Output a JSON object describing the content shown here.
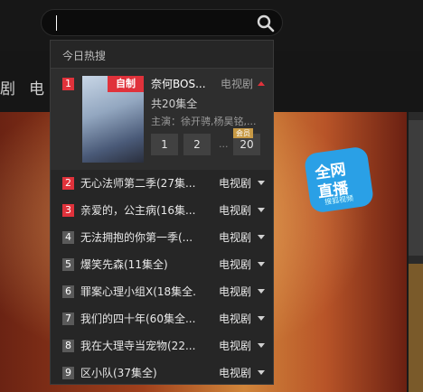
{
  "search": {
    "value": ""
  },
  "nav": {
    "items": [
      "剧",
      "电"
    ]
  },
  "live_badge": {
    "line1": "全网",
    "line2": "直播",
    "line3": "搜狐视频"
  },
  "dropdown": {
    "heading": "今日热搜",
    "featured": {
      "rank": "1",
      "poster_tag": "自制",
      "title": "奈何BOS...",
      "category": "电视剧",
      "episodes_total": "共20集全",
      "cast": "主演：徐开骋,杨昊铭,...",
      "episodes": [
        "1",
        "2",
        "20"
      ],
      "more": "···",
      "vip_label": "会员"
    },
    "rows": [
      {
        "rank": "2",
        "title": "无心法师第二季(27集...",
        "category": "电视剧",
        "hot": true
      },
      {
        "rank": "3",
        "title": "亲爱的，公主病(16集...",
        "category": "电视剧",
        "hot": true
      },
      {
        "rank": "4",
        "title": "无法拥抱的你第一季(...",
        "category": "电视剧",
        "hot": false
      },
      {
        "rank": "5",
        "title": "爆笑先森(11集全)",
        "category": "电视剧",
        "hot": false
      },
      {
        "rank": "6",
        "title": "罪案心理小组X(18集全...",
        "category": "电视剧",
        "hot": false
      },
      {
        "rank": "7",
        "title": "我们的四十年(60集全...",
        "category": "电视剧",
        "hot": false
      },
      {
        "rank": "8",
        "title": "我在大理寺当宠物(22...",
        "category": "电视剧",
        "hot": false
      },
      {
        "rank": "9",
        "title": "区小队(37集全)",
        "category": "电视剧",
        "hot": false
      }
    ]
  },
  "colors": {
    "hot_rank": "#e0323b",
    "rank": "#5a5a5a",
    "vip": "#c89a45",
    "badge": "#2aa0e6"
  }
}
